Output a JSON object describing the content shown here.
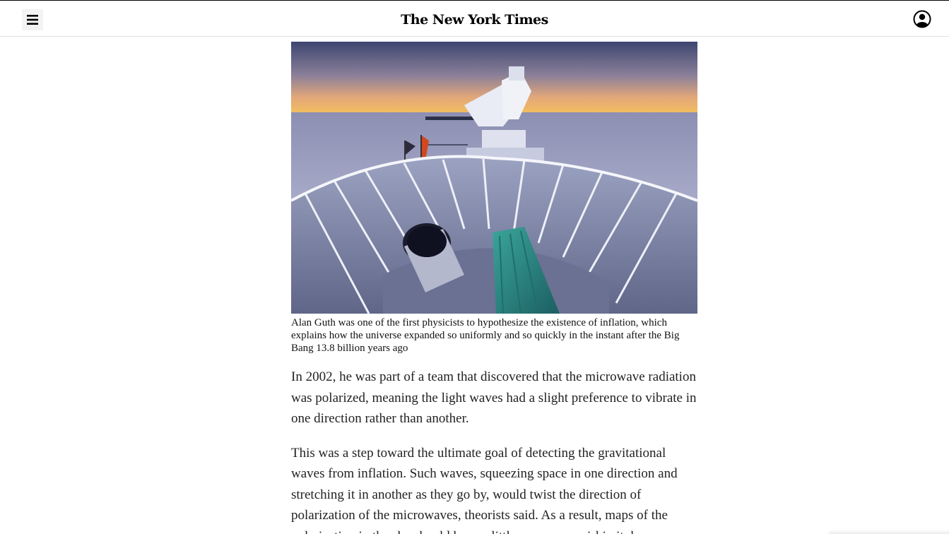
{
  "header": {
    "menu_icon": "hamburger-menu-icon",
    "masthead": "The New York Times",
    "account_icon": "user-account-icon"
  },
  "article": {
    "image_alt": "Telescope on Antarctic ice at dusk",
    "caption": "Alan Guth was one of the first physicists to hypothesize the existence of inflation, which explains how the universe expanded so uniformly and so quickly in the instant after the Big Bang 13.8 billion years ago",
    "paragraphs": [
      "In 2002, he was part of a team that discovered that the microwave radiation was polarized, meaning the light waves had a slight preference to vibrate in one direction rather than another.",
      "This was a step toward the ultimate goal of detecting the gravitational waves from inflation. Such waves, squeezing space in one direction and stretching it in another as they go by, would twist the direction of polarization of the microwaves, theorists said. As a result, maps of the polarization in the sky should have a little swoop or swirl in it, known as"
    ]
  },
  "colors": {
    "text": "#121212",
    "sky_top": "#3d4670",
    "sky_horizon": "#f6c15a",
    "ice": "#c9cde3",
    "dish": "#7f86a6",
    "teal": "#2b8a84"
  }
}
